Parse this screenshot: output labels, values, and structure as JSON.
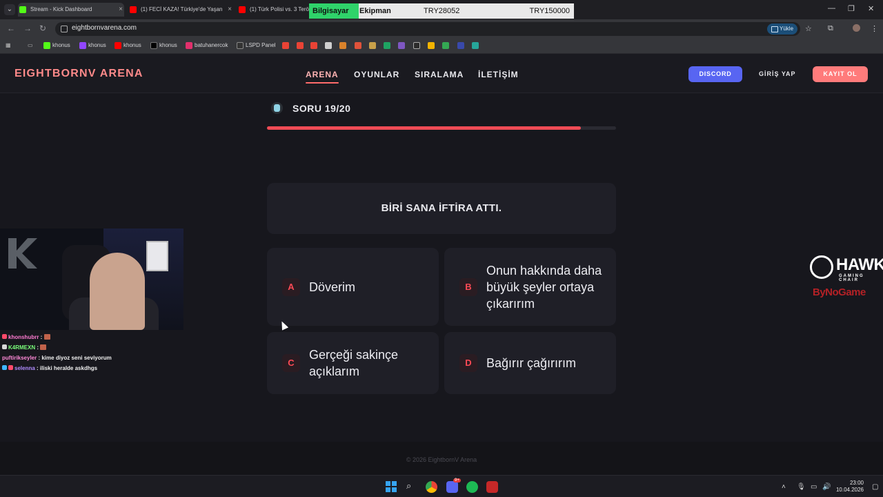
{
  "browser": {
    "tabs": [
      {
        "label": "Stream - Kick Dashboard",
        "color": "#53fc18"
      },
      {
        "label": "(1) FECİ KAZA! Türkiye'de Yaşan",
        "color": "#ff0000"
      },
      {
        "label": "(1) Türk Polisi vs. 3 Terö",
        "color": "#ff0000"
      }
    ],
    "overlay": {
      "label1": "Bilgisayar ve",
      "label2": "Ekipman",
      "value1": "TRY28052",
      "value2": "TRY150000"
    },
    "url": "eightbornvarena.com",
    "install_label": "Yükle",
    "bookmarks": [
      {
        "label": "khonus",
        "color": "#53fc18"
      },
      {
        "label": "khonus",
        "color": "#9146ff"
      },
      {
        "label": "khonus",
        "color": "#ff0000"
      },
      {
        "label": "khonus",
        "color": "#000000"
      },
      {
        "label": "batuhanercok",
        "color": "#e1306c"
      },
      {
        "label": "LSPD Panel",
        "color": "#333333"
      }
    ]
  },
  "site": {
    "logo": "EIGHTBORNV ARENA",
    "nav": [
      "ARENA",
      "OYUNLAR",
      "SIRALAMA",
      "İLETİŞİM"
    ],
    "discord_label": "DISCORD",
    "login_label": "GİRİŞ YAP",
    "register_label": "KAYIT OL",
    "accent": "#ff6b6b"
  },
  "quiz": {
    "counter": "SORU 19/20",
    "progress": 0.9,
    "question": "BİRİ SANA İFTİRA ATTI.",
    "answers": [
      {
        "letter": "A",
        "text": "Döverim"
      },
      {
        "letter": "B",
        "text": "Onun hakkında daha büyük şeyler ortaya çıkarırım"
      },
      {
        "letter": "C",
        "text": "Gerçeği sakinçe açıklarım"
      },
      {
        "letter": "D",
        "text": "Bağırır çağırırım"
      }
    ]
  },
  "footer": {
    "copyright": "© 2026 EightbornV Arena"
  },
  "stream_chat": [
    {
      "user": "khonshubrr",
      "message": ""
    },
    {
      "user": "K4RMEXN",
      "message": ""
    },
    {
      "user": "puftirikseyler",
      "message": "kime diyoz seni seviyorum"
    },
    {
      "user": "selenna",
      "message": "iliski heralde askdhgs"
    }
  ],
  "sponsor": {
    "brand": "HAWK",
    "sub": "GAMING CHAIR",
    "partner": "ByNoGame"
  },
  "taskbar": {
    "time": "23:00",
    "date": "10.04.2026",
    "discord_badge": "9+"
  }
}
